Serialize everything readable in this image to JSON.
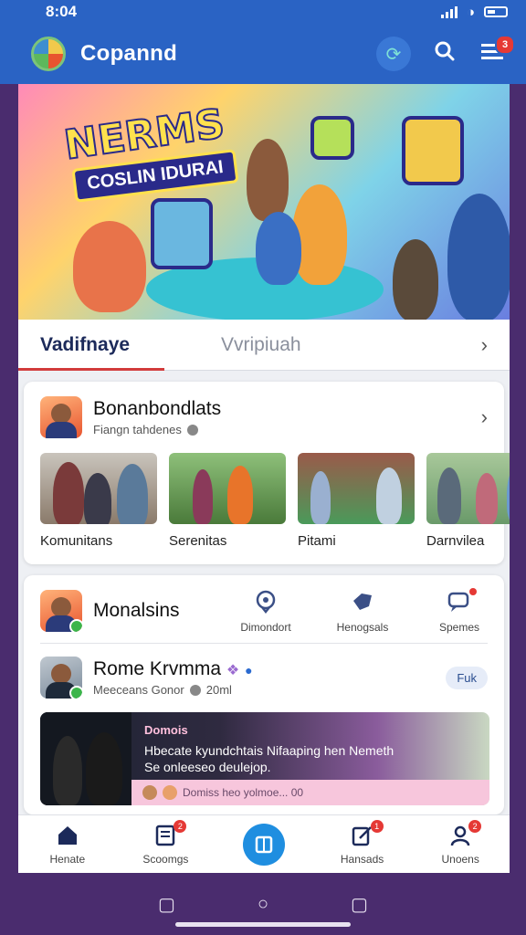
{
  "status": {
    "time": "8:04"
  },
  "app": {
    "title": "Copannd",
    "notification_count": "3"
  },
  "tabs": [
    {
      "label": "Vadifnaye",
      "active": true
    },
    {
      "label": "Vvripiuah",
      "active": false
    }
  ],
  "community_card": {
    "title": "Bonanbondlats",
    "subtitle": "Fiangn tahdenes",
    "items": [
      {
        "label": "Komunitans"
      },
      {
        "label": "Serenitas"
      },
      {
        "label": "Pitami"
      },
      {
        "label": "Darnvilea"
      }
    ]
  },
  "profile_card": {
    "name": "Monalsins",
    "actions": [
      {
        "label": "Dimondort",
        "icon": "location-pin-icon"
      },
      {
        "label": "Henogsals",
        "icon": "tag-icon"
      },
      {
        "label": "Spemes",
        "icon": "chat-bubble-icon"
      }
    ],
    "post": {
      "author": "Rome Krvmma",
      "meta": "Meeceans Gonor",
      "time": "20ml",
      "follow_label": "Fuk"
    },
    "banner": {
      "tag": "Domois",
      "line1": "Hbecate kyundchtais Nifaaping hen Nemeth",
      "line2": "Se onleeseo          deulejop.",
      "footer": "Domiss heo yolmoe... 00"
    }
  },
  "bottom_nav": [
    {
      "label": "Henate",
      "icon": "home-icon",
      "badge": ""
    },
    {
      "label": "Scoomgs",
      "icon": "document-icon",
      "badge": "2"
    },
    {
      "label": "",
      "icon": "book-icon",
      "badge": ""
    },
    {
      "label": "Hansads",
      "icon": "edit-icon",
      "badge": "1"
    },
    {
      "label": "Unoens",
      "icon": "user-icon",
      "badge": "2"
    }
  ],
  "colors": {
    "appbar": "#2a63c4",
    "accent": "#d23b3b",
    "nav_center": "#1f8ee0"
  }
}
